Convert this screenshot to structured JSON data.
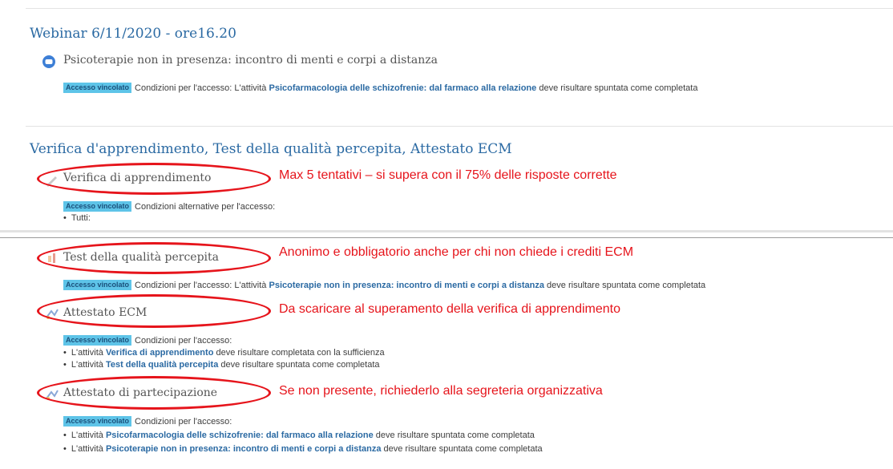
{
  "section1": {
    "title": "Webinar 6/11/2020 - ore16.20",
    "activity": "Psicoterapie non in presenza: incontro di menti e corpi a distanza",
    "restriction": {
      "badge": "Accesso vincolato",
      "prefix": "Condizioni per l'accesso: L'attività ",
      "link": "Psicofarmacologia delle schizofrenie: dal farmaco alla relazione",
      "suffix": " deve risultare spuntata come completata"
    }
  },
  "section2": {
    "title": "Verifica d'apprendimento, Test della qualità percepita, Attestato ECM",
    "verifica": {
      "name": "Verifica di apprendimento",
      "note": "Max 5 tentativi – si supera con il 75% delle risposte corrette",
      "badge": "Accesso vincolato",
      "conditions": "Condizioni alternative per l'accesso:",
      "bullet": "Tutti:"
    },
    "test": {
      "name": "Test della qualità percepita",
      "note": "Anonimo e obbligatorio anche per chi non chiede i crediti ECM",
      "badge": "Accesso vincolato",
      "prefix": "Condizioni per l'accesso: L'attività ",
      "link": "Psicoterapie non in presenza: incontro di menti e corpi a distanza",
      "suffix": " deve risultare spuntata come completata"
    },
    "attestato_ecm": {
      "name": "Attestato ECM",
      "note": "Da scaricare al superamento della verifica di apprendimento",
      "badge": "Accesso vincolato",
      "conditions": "Condizioni per l'accesso:",
      "items": [
        {
          "prefix": "L'attività ",
          "link": "Verifica di apprendimento",
          "suffix": " deve risultare completata con la sufficienza"
        },
        {
          "prefix": "L'attività ",
          "link": "Test della qualità percepita",
          "suffix": " deve risultare spuntata come completata"
        }
      ]
    },
    "attestato_partecipazione": {
      "name": "Attestato di partecipazione",
      "note": "Se non presente, richiederlo alla segreteria organizzativa",
      "badge": "Accesso vincolato",
      "conditions": "Condizioni per l'accesso:",
      "items": [
        {
          "prefix": "L'attività ",
          "link": "Psicofarmacologia delle schizofrenie: dal farmaco alla relazione",
          "suffix": " deve risultare spuntata come completata"
        },
        {
          "prefix": "L'attività ",
          "link": "Psicoterapie non in presenza: incontro di menti e corpi a distanza",
          "suffix": " deve risultare spuntata come completata"
        }
      ]
    }
  },
  "colors": {
    "accent": "#2b6aa3",
    "badge": "#5ec4e8",
    "annotation": "#e6141b"
  }
}
